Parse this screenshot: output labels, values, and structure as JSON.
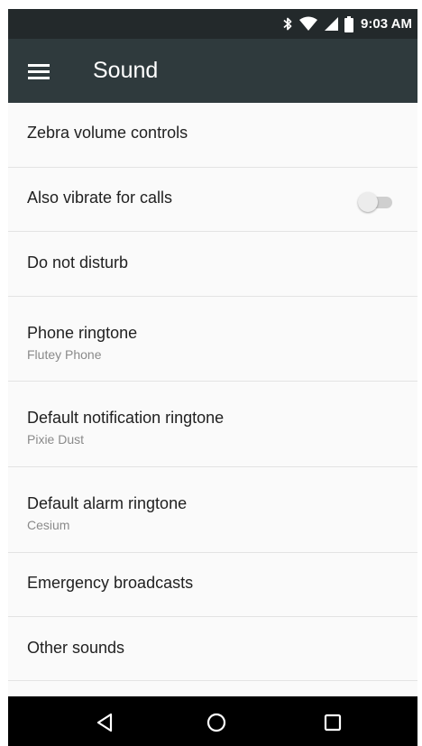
{
  "status_bar": {
    "time": "9:03 AM",
    "icons": [
      "bluetooth-icon",
      "wifi-icon",
      "signal-icon",
      "battery-icon"
    ]
  },
  "app_bar": {
    "title": "Sound",
    "menu_icon": "hamburger-menu-icon"
  },
  "settings": {
    "items": [
      {
        "title": "Zebra volume controls",
        "subtitle": ""
      },
      {
        "title": "Also vibrate for calls",
        "subtitle": "",
        "toggle": false
      },
      {
        "title": "Do not disturb",
        "subtitle": ""
      },
      {
        "title": "Phone ringtone",
        "subtitle": "Flutey Phone"
      },
      {
        "title": "Default notification ringtone",
        "subtitle": "Pixie Dust"
      },
      {
        "title": "Default alarm ringtone",
        "subtitle": "Cesium"
      },
      {
        "title": "Emergency broadcasts",
        "subtitle": ""
      },
      {
        "title": "Other sounds",
        "subtitle": ""
      }
    ]
  },
  "nav_bar": {
    "buttons": [
      "back-icon",
      "home-icon",
      "recents-icon"
    ]
  },
  "colors": {
    "status_bar": "#23292b",
    "app_bar": "#2f3a3d",
    "background": "#fafafa",
    "divider": "#e3e3e3",
    "nav_bar": "#000000"
  }
}
